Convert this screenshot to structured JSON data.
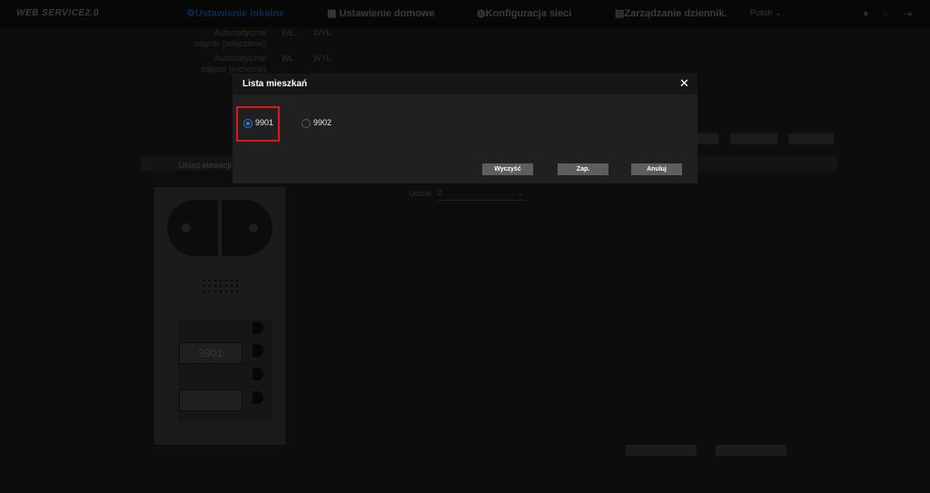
{
  "app": {
    "logo": "WEB SERVICE2.0"
  },
  "nav": [
    {
      "label": "Ustawienie lokalne",
      "icon": "settings-icon"
    },
    {
      "label": "Ustawienie domowe",
      "icon": "home-icon"
    },
    {
      "label": "Konfiguracja sieci",
      "icon": "globe-icon"
    },
    {
      "label": "Zarządzanie dziennik.",
      "icon": "log-icon"
    }
  ],
  "language": "Polish",
  "background": {
    "rows": [
      {
        "label": "Automatyczne zdjęcie (połączenie)",
        "on": "WŁ.",
        "off": "WYŁ."
      },
      {
        "label": "Automatyczne zdjęcie (ruchomo)",
        "on": "WŁ.",
        "off": "WYŁ."
      }
    ],
    "section_title": "Układ elewacji",
    "unit_label": "Ucznik",
    "unit_value": "2",
    "apartment_card": "9901"
  },
  "modal": {
    "title": "Lista mieszkań",
    "options": [
      {
        "label": "9901",
        "checked": true
      },
      {
        "label": "9902",
        "checked": false
      }
    ],
    "buttons": {
      "clear": "Wyczyść",
      "save": "Zap.",
      "cancel": "Anuluj"
    }
  },
  "colors": {
    "accent": "#2d7ad6",
    "highlight": "#e0151b",
    "modal_bg": "#202020",
    "button_bg": "#5e5e5e"
  }
}
